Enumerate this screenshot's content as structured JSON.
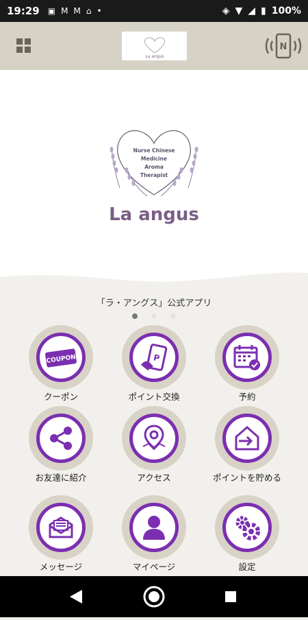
{
  "status": {
    "time": "19:29",
    "battery": "100%"
  },
  "header": {
    "logo_text": "La angus"
  },
  "hero": {
    "emblem_lines": [
      "Nurse Chinese",
      "Medicine",
      "Aroma",
      "Therapist"
    ],
    "brand": "La angus"
  },
  "app_title": "「ラ・アングス」公式アプリ",
  "pager": {
    "count": 3,
    "active": 1
  },
  "menu": [
    {
      "label": "クーポン",
      "icon": "coupon-icon"
    },
    {
      "label": "ポイント交換",
      "icon": "point-exchange-icon"
    },
    {
      "label": "予約",
      "icon": "calendar-icon"
    },
    {
      "label": "お友達に紹介",
      "icon": "share-icon"
    },
    {
      "label": "アクセス",
      "icon": "map-pin-icon"
    },
    {
      "label": "ポイントを貯める",
      "icon": "checkin-icon"
    },
    {
      "label": "メッセージ",
      "icon": "mail-icon"
    },
    {
      "label": "マイページ",
      "icon": "user-icon"
    },
    {
      "label": "設定",
      "icon": "gear-icon"
    }
  ],
  "colors": {
    "accent": "#7b2fb0",
    "toolbar": "#d6d2c6",
    "tile_ring": "#d8d3c6",
    "background": "#f2f0ec",
    "brand": "#7a5f85"
  },
  "coupon_badge": "COUPON",
  "nfc_letter": "N"
}
